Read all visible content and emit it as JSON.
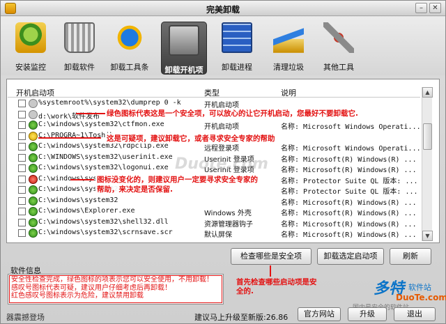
{
  "window": {
    "title": "完美卸载"
  },
  "toolbar": {
    "items": [
      {
        "label": "安装监控",
        "icon": "install-monitor-icon"
      },
      {
        "label": "卸载软件",
        "icon": "trash-can-icon"
      },
      {
        "label": "卸载工具条",
        "icon": "ie-toolbar-icon"
      },
      {
        "label": "卸载开机项",
        "icon": "startup-computer-icon",
        "active": true
      },
      {
        "label": "卸载进程",
        "icon": "process-icon"
      },
      {
        "label": "清理垃圾",
        "icon": "broom-icon"
      },
      {
        "label": "其他工具",
        "icon": "tools-icon"
      }
    ]
  },
  "list": {
    "headers": {
      "name": "开机启动项",
      "type": "类型",
      "desc": "说明"
    },
    "rows": [
      {
        "status": "none",
        "cmd": "%systemroot%\\system32\\dumprep 0 -k",
        "type": "开机启动项",
        "desc": ""
      },
      {
        "status": "none",
        "cmd": "d:\\work\\软件发布",
        "type": "",
        "desc": ""
      },
      {
        "status": "safe",
        "cmd": "C:\\windows\\system32\\ctfmon.exe",
        "type": "开机启动项",
        "desc": "名称: Microsoft Windows Operati..."
      },
      {
        "status": "warn",
        "cmd": "C:\\PROGRA~1\\Toshib",
        "type": "",
        "desc": ""
      },
      {
        "status": "safe",
        "cmd": "C:\\windows\\system32\\rdpclip.exe",
        "type": "远程登录项",
        "desc": "名称: Microsoft Windows Operati..."
      },
      {
        "status": "safe",
        "cmd": "C:\\WINDOWS\\system32\\userinit.exe",
        "type": "Userinit 登录项",
        "desc": "名称: Microsoft(R) Windows(R) ..."
      },
      {
        "status": "safe",
        "cmd": "C:\\windows\\system32\\logonui.exe",
        "type": "Userinit 登录项",
        "desc": "名称: Microsoft(R) Windows(R) ..."
      },
      {
        "status": "dang",
        "cmd": "C:\\windows\\sys",
        "type": "",
        "desc": "名称: Protector Suite QL 版本: ..."
      },
      {
        "status": "safe",
        "cmd": "C:\\windows\\system32",
        "type": "",
        "desc": "名称: Protector Suite QL 版本: ..."
      },
      {
        "status": "safe",
        "cmd": "C:\\windows\\system32",
        "type": "",
        "desc": "名称: Microsoft(R) Windows(R) ..."
      },
      {
        "status": "safe",
        "cmd": "C:\\windows\\Explorer.exe",
        "type": "Windows 外壳",
        "desc": "名称: Microsoft(R) Windows(R) ..."
      },
      {
        "status": "safe",
        "cmd": "C:\\windows\\system32\\shell32.dll",
        "type": "资源管理器钩子",
        "desc": "名称: Microsoft(R) Windows(R) ..."
      },
      {
        "status": "safe",
        "cmd": "C:\\windows\\system32\\scrnsave.scr",
        "type": "默认屏保",
        "desc": "名称: Microsoft(R) Windows(R) ..."
      }
    ]
  },
  "annotations": {
    "safe": "绿色图标代表这是一个安全项，可以放心的让它开机启动，您最好不要卸载它.",
    "warn": "这是可疑项，建议卸载它，或者寻求安全专家的帮助",
    "dang_line1": "图标没变化的，则建议用户一定要寻求安全专家的",
    "dang_line2": "帮助，来决定是否保留.",
    "check_first": "首先检查哪些启动项是安全的."
  },
  "watermark": "Duote.com",
  "buttons": {
    "check_safe": "检查哪些是安全项",
    "uninstall_selected": "卸载选定启动项",
    "refresh": "刷新",
    "website": "官方网站",
    "upgrade": "升级",
    "exit": "退出"
  },
  "info": {
    "title": "软件信息",
    "lines": [
      "安全性检查完成，绿色图标的项表示您可以安全使用，不用卸载！",
      "感叹号图标代表可疑，建议用户仔细考虑后再卸载！",
      "红色感叹号图标表示为危险，建议禁用卸载"
    ]
  },
  "status": {
    "left": "器震撼登场",
    "upgrade_hint": "建议马上升级至新版:26.86"
  },
  "logo": {
    "big": "多特",
    "small": "软件站",
    "url": "DuoTe.com",
    "sub": "国内最安全的软件站"
  }
}
